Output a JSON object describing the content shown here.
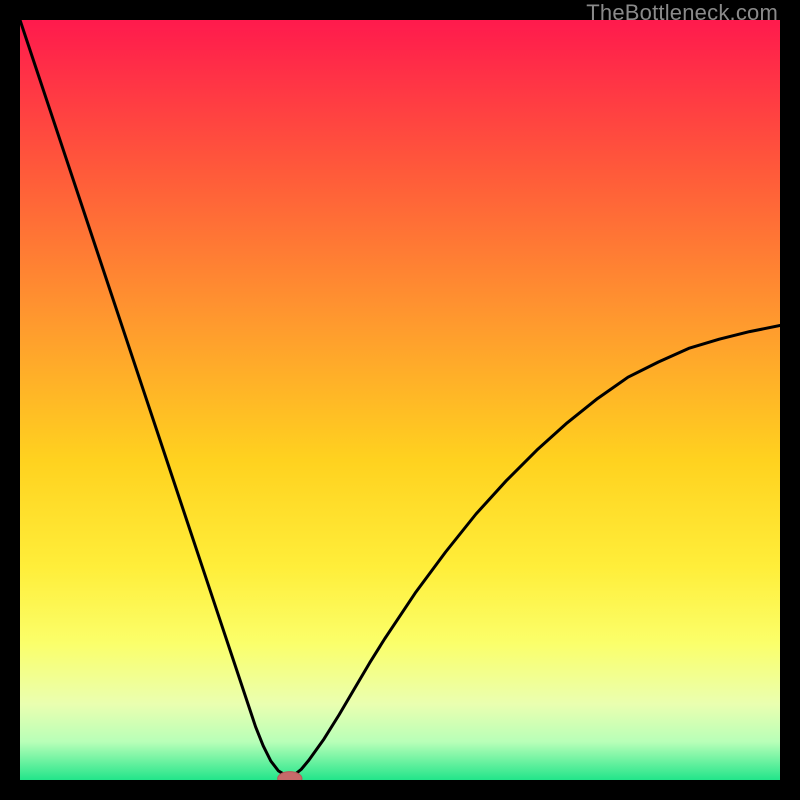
{
  "watermark": "TheBottleneck.com",
  "colors": {
    "frame": "#000000",
    "curve": "#000000",
    "marker_fill": "#c76a6a",
    "marker_stroke": "#b45a5a"
  },
  "chart_data": {
    "type": "line",
    "title": "",
    "xlabel": "",
    "ylabel": "",
    "xlim": [
      0,
      100
    ],
    "ylim": [
      0,
      100
    ],
    "gradient_stops": [
      {
        "offset": 0.0,
        "color": "#ff1a4d"
      },
      {
        "offset": 0.2,
        "color": "#ff5a3a"
      },
      {
        "offset": 0.4,
        "color": "#ff9a2e"
      },
      {
        "offset": 0.58,
        "color": "#ffd21f"
      },
      {
        "offset": 0.72,
        "color": "#ffee3a"
      },
      {
        "offset": 0.82,
        "color": "#fbff6a"
      },
      {
        "offset": 0.9,
        "color": "#eaffb0"
      },
      {
        "offset": 0.95,
        "color": "#b8ffb8"
      },
      {
        "offset": 1.0,
        "color": "#22e58a"
      }
    ],
    "series": [
      {
        "name": "bottleneck-curve",
        "x": [
          0,
          2,
          4,
          6,
          8,
          10,
          12,
          14,
          16,
          18,
          20,
          22,
          24,
          26,
          28,
          30,
          31,
          32,
          33,
          34,
          35,
          36,
          37,
          38,
          40,
          42,
          44,
          46,
          48,
          52,
          56,
          60,
          64,
          68,
          72,
          76,
          80,
          84,
          88,
          92,
          96,
          100
        ],
        "y": [
          100,
          94,
          88,
          82,
          76,
          70,
          64,
          58,
          52,
          46,
          40,
          34,
          28,
          22,
          16,
          10,
          7,
          4.5,
          2.5,
          1.2,
          0.6,
          0.6,
          1.4,
          2.6,
          5.4,
          8.6,
          12.0,
          15.4,
          18.6,
          24.6,
          30.0,
          35.0,
          39.4,
          43.4,
          47.0,
          50.2,
          53.0,
          55.0,
          56.8,
          58.0,
          59.0,
          59.8
        ]
      }
    ],
    "marker": {
      "x": 35.5,
      "y": 0.2,
      "rx": 1.6,
      "ry": 0.9
    }
  }
}
